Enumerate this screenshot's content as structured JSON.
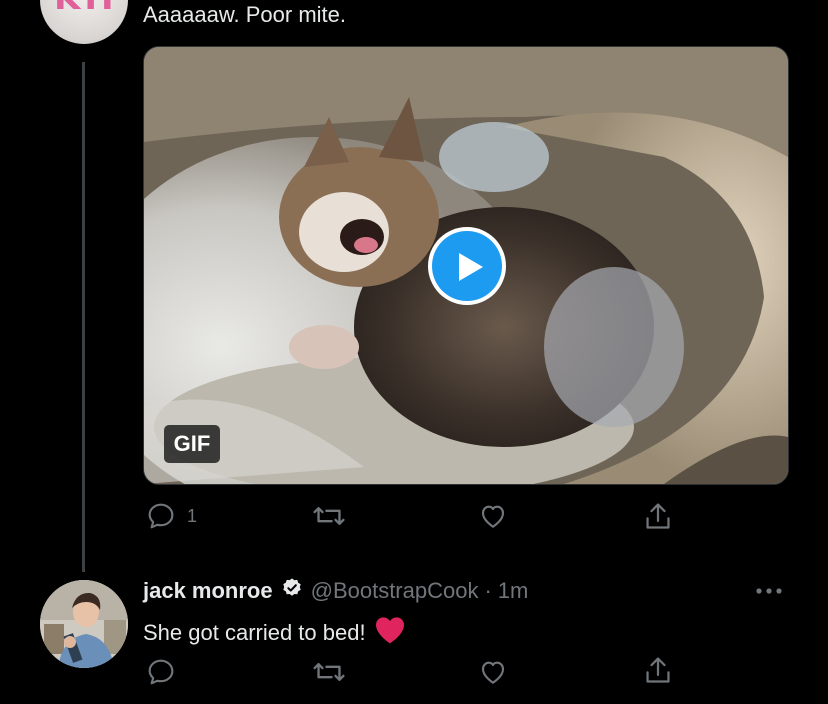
{
  "tweet1": {
    "text": "Aaaaaaw. Poor mite.",
    "media": {
      "badge": "GIF",
      "alt": "kitten yawning on a fluffy bed"
    },
    "actions": {
      "reply_count": "1",
      "retweet_count": "",
      "like_count": ""
    }
  },
  "tweet2": {
    "display_name": "jack monroe",
    "handle": "@BootstrapCook",
    "separator": "·",
    "time": "1m",
    "text": "She got carried to bed!",
    "emoji": "heart"
  },
  "colors": {
    "background": "#000000",
    "text": "#e7e9ea",
    "secondary": "#71767b",
    "accent_blue": "#1d9bf0",
    "heart_red": "#e0245e"
  },
  "icons": [
    "reply-icon",
    "retweet-icon",
    "like-icon",
    "share-icon",
    "more-icon",
    "verified-icon",
    "play-icon"
  ]
}
